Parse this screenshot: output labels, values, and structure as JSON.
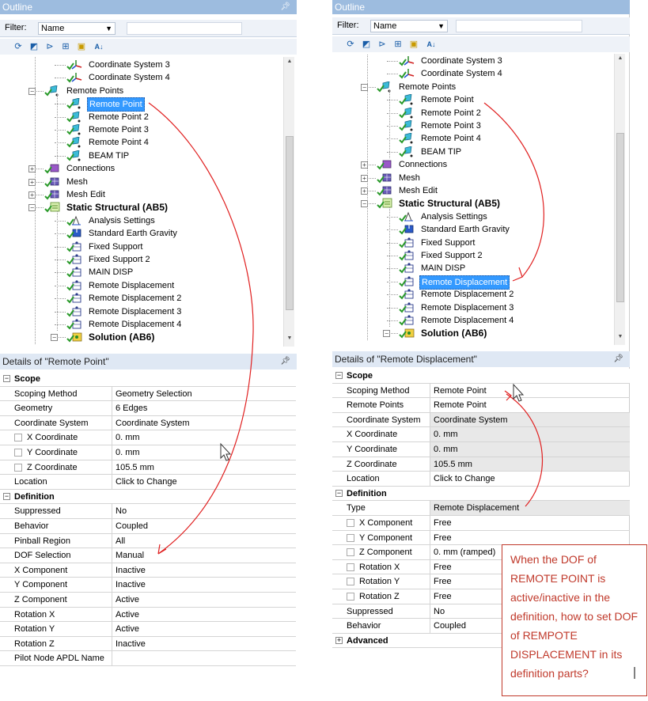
{
  "left": {
    "outline_title": "Outline",
    "filter_label": "Filter:",
    "filter_value": "Name",
    "tree": [
      "Coordinate System 3",
      "Coordinate System 4",
      "Remote Points",
      "Remote Point",
      "Remote Point 2",
      "Remote Point 3",
      "Remote Point 4",
      "BEAM TIP",
      "Connections",
      "Mesh",
      "Mesh Edit",
      "Static Structural (AB5)",
      "Analysis Settings",
      "Standard Earth Gravity",
      "Fixed Support",
      "Fixed Support 2",
      "MAIN DISP",
      "Remote Displacement",
      "Remote Displacement 2",
      "Remote Displacement 3",
      "Remote Displacement 4",
      "Solution (AB6)"
    ],
    "details_title": "Details of \"Remote Point\"",
    "scope_label": "Scope",
    "definition_label": "Definition",
    "scope_rows": [
      [
        "Scoping Method",
        "Geometry Selection"
      ],
      [
        "Geometry",
        "6 Edges"
      ],
      [
        "Coordinate System",
        "Coordinate System"
      ],
      [
        "X Coordinate",
        "0. mm"
      ],
      [
        "Y Coordinate",
        "0. mm"
      ],
      [
        "Z Coordinate",
        "105.5 mm"
      ],
      [
        "Location",
        "Click to Change"
      ]
    ],
    "definition_rows": [
      [
        "Suppressed",
        "No"
      ],
      [
        "Behavior",
        "Coupled"
      ],
      [
        "Pinball Region",
        "All"
      ],
      [
        "DOF Selection",
        "Manual"
      ],
      [
        "X Component",
        "Inactive"
      ],
      [
        "Y Component",
        "Inactive"
      ],
      [
        "Z Component",
        "Active"
      ],
      [
        " Rotation X",
        "Active"
      ],
      [
        " Rotation Y",
        "Active"
      ],
      [
        " Rotation Z",
        "Inactive"
      ],
      [
        "Pilot Node APDL Name",
        ""
      ]
    ]
  },
  "right": {
    "outline_title": "Outline",
    "filter_label": "Filter:",
    "filter_value": "Name",
    "tree": [
      "Coordinate System 3",
      "Coordinate System 4",
      "Remote Points",
      "Remote Point",
      "Remote Point 2",
      "Remote Point 3",
      "Remote Point 4",
      "BEAM TIP",
      "Connections",
      "Mesh",
      "Mesh Edit",
      "Static Structural (AB5)",
      "Analysis Settings",
      "Standard Earth Gravity",
      "Fixed Support",
      "Fixed Support 2",
      "MAIN DISP",
      "Remote Displacement",
      "Remote Displacement 2",
      "Remote Displacement 3",
      "Remote Displacement 4",
      "Solution (AB6)"
    ],
    "details_title": "Details of \"Remote Displacement\"",
    "scope_label": "Scope",
    "definition_label": "Definition",
    "advanced_label": "Advanced",
    "scope_rows": [
      [
        "Scoping Method",
        "Remote Point"
      ],
      [
        "Remote Points",
        "Remote Point"
      ],
      [
        "Coordinate System",
        "Coordinate System"
      ],
      [
        "X Coordinate",
        "0. mm"
      ],
      [
        "Y Coordinate",
        "0. mm"
      ],
      [
        "Z Coordinate",
        "105.5 mm"
      ],
      [
        "Location",
        "Click to Change"
      ]
    ],
    "definition_rows": [
      [
        "Type",
        "Remote Displacement"
      ],
      [
        "X Component",
        "Free"
      ],
      [
        "Y Component",
        "Free"
      ],
      [
        "Z Component",
        "0. mm  (ramped)"
      ],
      [
        " Rotation X",
        "Free"
      ],
      [
        " Rotation Y",
        "Free"
      ],
      [
        " Rotation Z",
        "Free"
      ],
      [
        "Suppressed",
        "No"
      ],
      [
        "Behavior",
        "Coupled"
      ]
    ]
  },
  "callout": "When the DOF of REMOTE POINT is active/inactive in the definition, how to set DOF of REMPOTE DISPLACEMENT in its definition parts?",
  "colors": {
    "title_bar": "#9dbcdf",
    "selection": "#3399ff",
    "annotation": "#e02020"
  }
}
